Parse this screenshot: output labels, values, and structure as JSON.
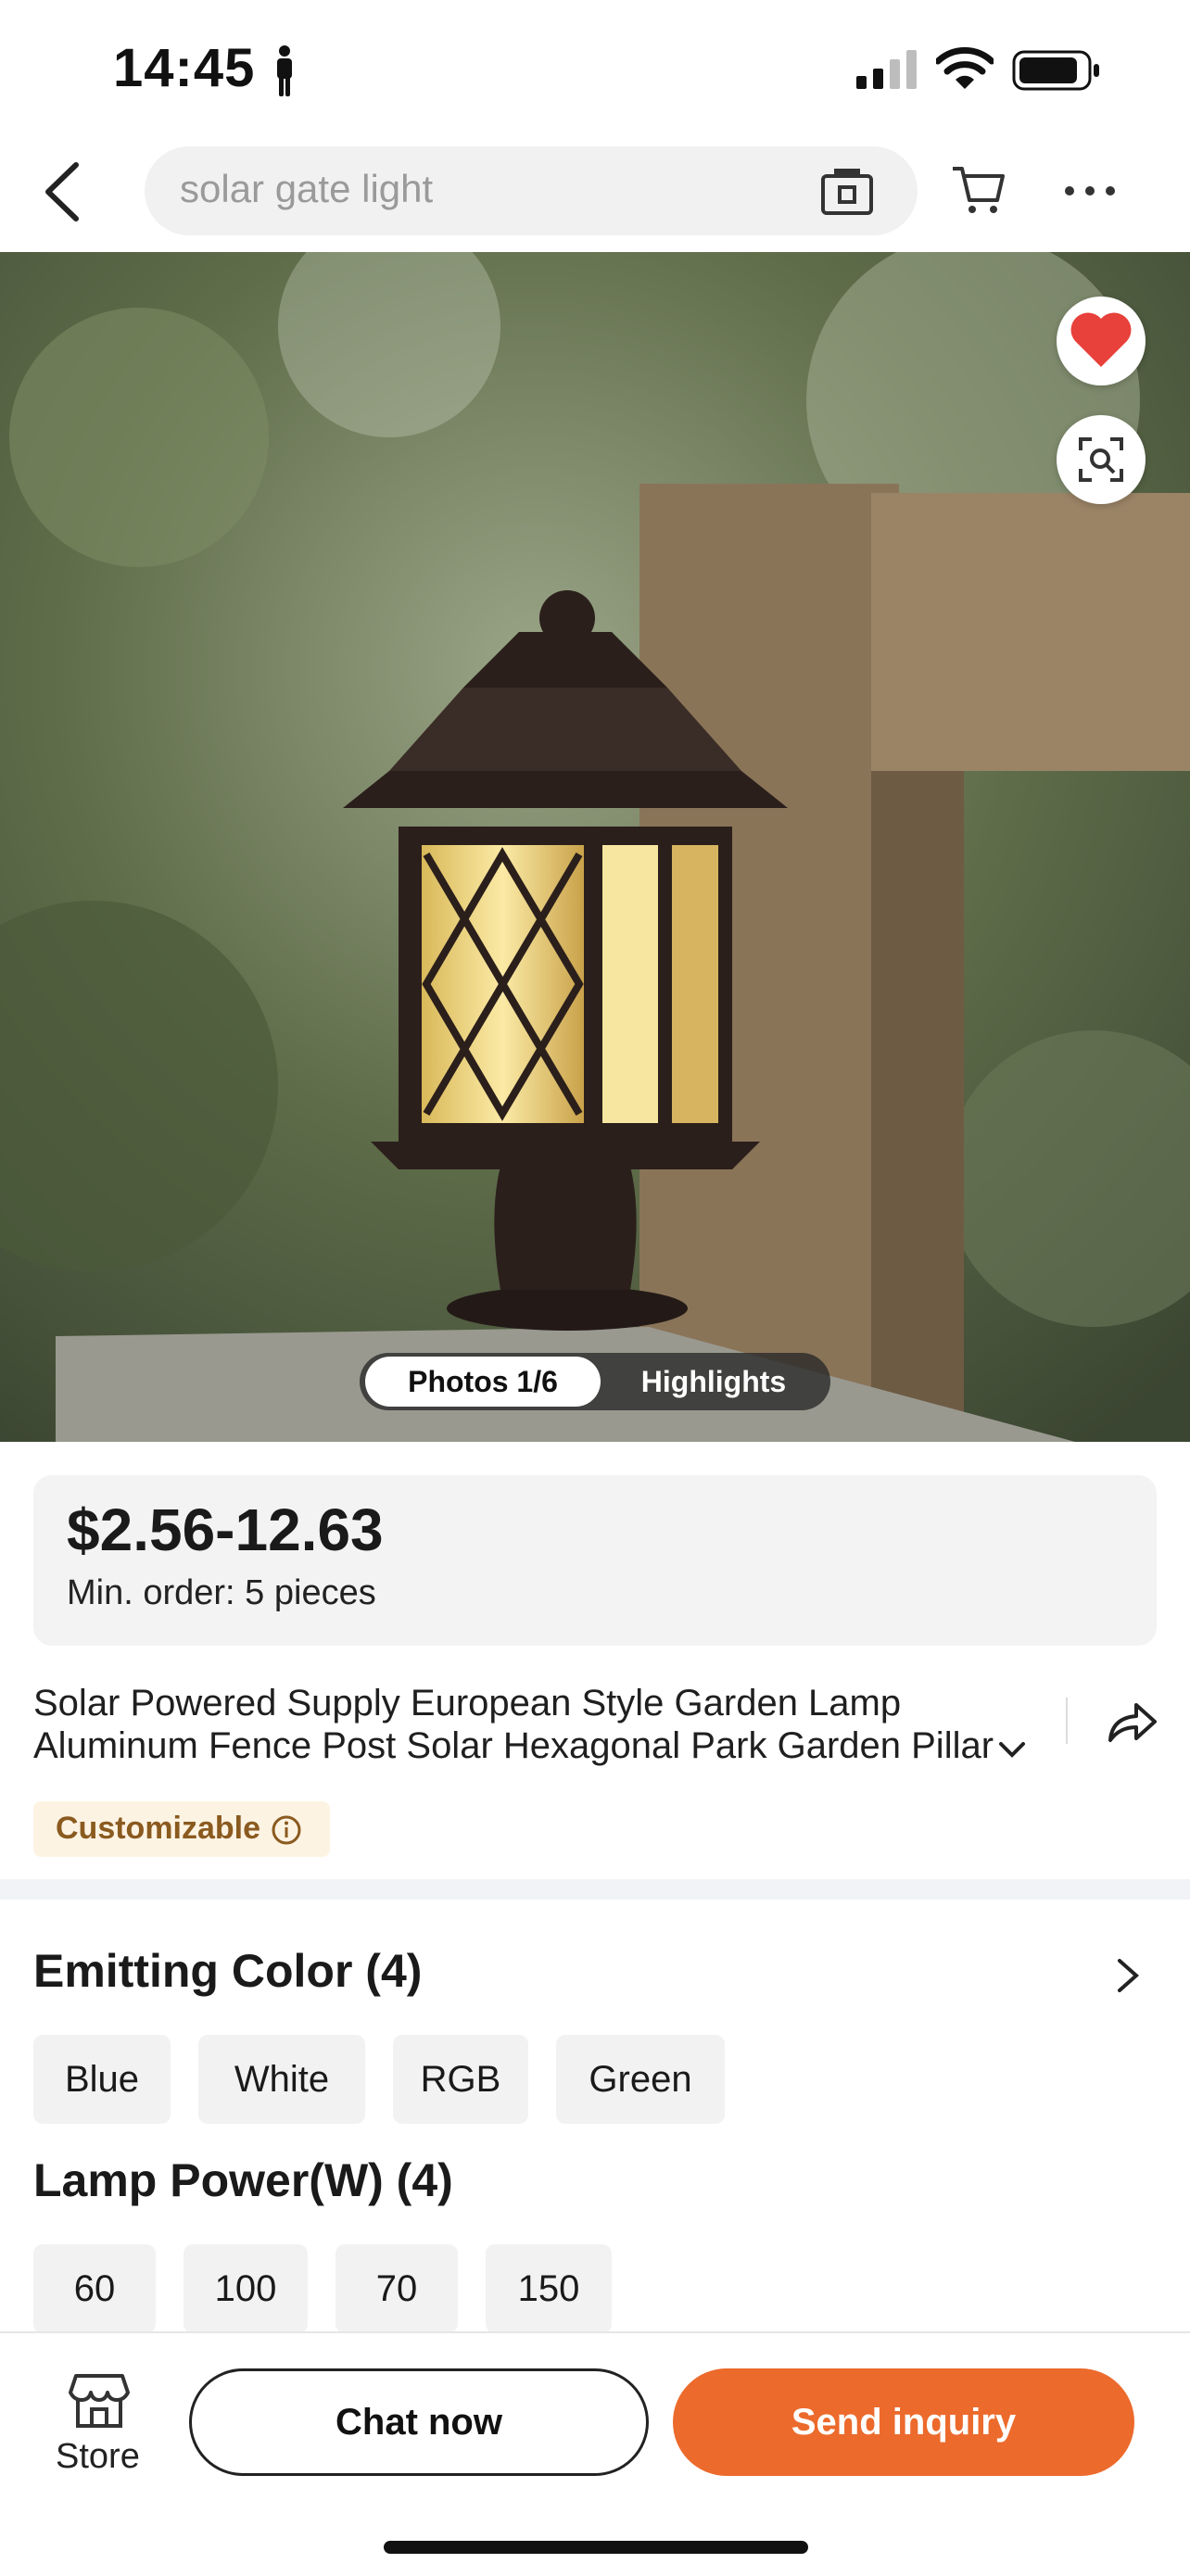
{
  "status_bar": {
    "time": "14:45"
  },
  "nav": {
    "search_text": "solar gate light"
  },
  "gallery": {
    "photos_tab": "Photos 1/6",
    "highlights_tab": "Highlights"
  },
  "price": {
    "range": "$2.56-12.63",
    "min_order": "Min. order: 5 pieces"
  },
  "product": {
    "title_line1": "Solar Powered Supply European Style Garden Lamp",
    "title_line2": "Aluminum Fence Post Solar Hexagonal Park Garden Pillar",
    "badge": "Customizable"
  },
  "options": {
    "emitting_color": {
      "title": "Emitting Color (4)",
      "values": [
        "Blue",
        "White",
        "RGB",
        "Green"
      ]
    },
    "lamp_power": {
      "title": "Lamp Power(W) (4)",
      "values": [
        "60",
        "100",
        "70",
        "150"
      ]
    }
  },
  "bottom_bar": {
    "store_label": "Store",
    "chat_label": "Chat now",
    "inquiry_label": "Send inquiry"
  },
  "colors": {
    "accent": "#ec6a2c",
    "favorite": "#e8403a"
  }
}
